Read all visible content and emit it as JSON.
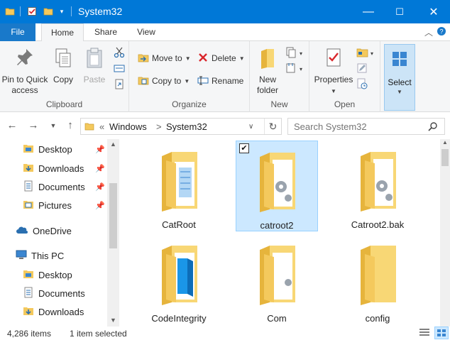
{
  "window": {
    "title": "System32",
    "controls": {
      "minimize": "—",
      "maximize": "☐",
      "close": "✕"
    },
    "quick_access_icons": [
      "folder-icon",
      "checklist-icon",
      "folder-icon",
      "customize-toolbar-icon"
    ]
  },
  "tabs": [
    {
      "label": "File"
    },
    {
      "label": "Home"
    },
    {
      "label": "Share"
    },
    {
      "label": "View"
    }
  ],
  "ribbon": {
    "clipboard": {
      "label": "Clipboard",
      "pin": "Pin to Quick access",
      "pin_line1": "Pin to Quick",
      "pin_line2": "access",
      "copy": "Copy",
      "paste": "Paste"
    },
    "organize": {
      "label": "Organize",
      "move_to": "Move to",
      "copy_to": "Copy to",
      "delete": "Delete",
      "rename": "Rename"
    },
    "new": {
      "label": "New",
      "new_folder_line1": "New",
      "new_folder_line2": "folder"
    },
    "open": {
      "label": "Open",
      "properties": "Properties"
    },
    "select": {
      "label": "Select"
    }
  },
  "address": {
    "overflow": "«",
    "crumbs": [
      "Windows",
      "System32"
    ],
    "separator": ">",
    "search_placeholder": "Search System32"
  },
  "nav": {
    "quick_access": [
      "Desktop",
      "Downloads",
      "Documents",
      "Pictures"
    ],
    "onedrive": "OneDrive",
    "this_pc": "This PC",
    "this_pc_items": [
      "Desktop",
      "Documents",
      "Downloads"
    ]
  },
  "files": [
    {
      "name": "CatRoot",
      "selected": false
    },
    {
      "name": "catroot2",
      "selected": true
    },
    {
      "name": "Catroot2.bak",
      "selected": false
    },
    {
      "name": "CodeIntegrity",
      "selected": false
    },
    {
      "name": "Com",
      "selected": false
    },
    {
      "name": "config",
      "selected": false
    }
  ],
  "status": {
    "item_count": "4,286 items",
    "selection": "1 item selected"
  },
  "colors": {
    "accent": "#0078d7",
    "folder": "#f4c95d",
    "selection": "#cce8ff"
  }
}
